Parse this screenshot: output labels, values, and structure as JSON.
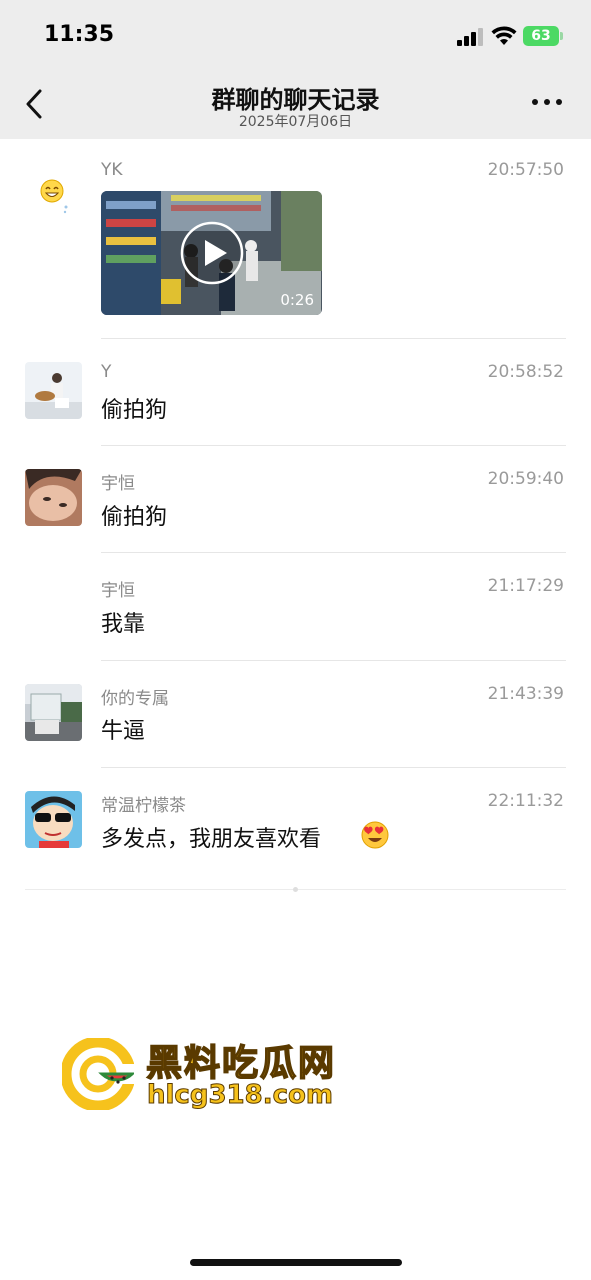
{
  "status_bar": {
    "time": "11:35",
    "battery": "63"
  },
  "nav": {
    "title": "群聊的聊天记录",
    "date": "2025年07月06日"
  },
  "messages": [
    {
      "sender": "YK",
      "time": "20:57:50",
      "type": "video",
      "video_duration": "0:26"
    },
    {
      "sender": "Y",
      "time": "20:58:52",
      "text": "偷拍狗"
    },
    {
      "sender": "宇恒",
      "time": "20:59:40",
      "text": "偷拍狗"
    },
    {
      "sender": "宇恒",
      "time": "21:17:29",
      "text": "我靠"
    },
    {
      "sender": "你的专属",
      "time": "21:43:39",
      "text": "牛逼"
    },
    {
      "sender": "常温柠檬茶",
      "time": "22:11:32",
      "text": "多发点，我朋友喜欢看"
    }
  ],
  "watermark": {
    "title": "黑料吃瓜网",
    "url": "hlcg318.com"
  },
  "colors": {
    "topbar": "#ededed",
    "battery": "#4cd964",
    "watermark": "#f6c21c"
  },
  "icons": [
    "back-arrow-icon",
    "more-icon",
    "signal-icon",
    "wifi-icon",
    "battery-icon",
    "play-icon",
    "heart-eyes-emoji-icon"
  ]
}
